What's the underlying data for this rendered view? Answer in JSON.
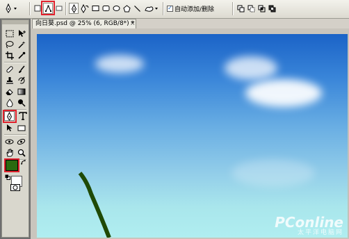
{
  "options_bar": {
    "auto_add_delete": {
      "checked": true,
      "label": "自动添加/删除"
    }
  },
  "document": {
    "tab_title": "向日葵.psd @ 25% (6, RGB/8*)",
    "tab_modified": "*",
    "close_glyph": "×"
  },
  "watermark": {
    "brand": "PConline",
    "subtitle": "太平洋电脑网"
  },
  "colors": {
    "highlight": "#e0202c",
    "foreground": "#2a6a10",
    "background": "#ffffff",
    "stem": "#1f4a06"
  },
  "tools": {
    "active": "pen-tool",
    "icons": [
      "marquee-icon",
      "move-icon",
      "lasso-icon",
      "magic-wand-icon",
      "crop-icon",
      "eyedropper-icon",
      "healing-brush-icon",
      "brush-icon",
      "clone-stamp-icon",
      "history-brush-icon",
      "eraser-icon",
      "gradient-icon",
      "blur-icon",
      "dodge-icon",
      "pen-icon",
      "type-icon",
      "path-selection-icon",
      "rectangle-icon",
      "3d-rotate-icon",
      "3d-orbit-icon",
      "hand-icon",
      "zoom-icon"
    ]
  }
}
